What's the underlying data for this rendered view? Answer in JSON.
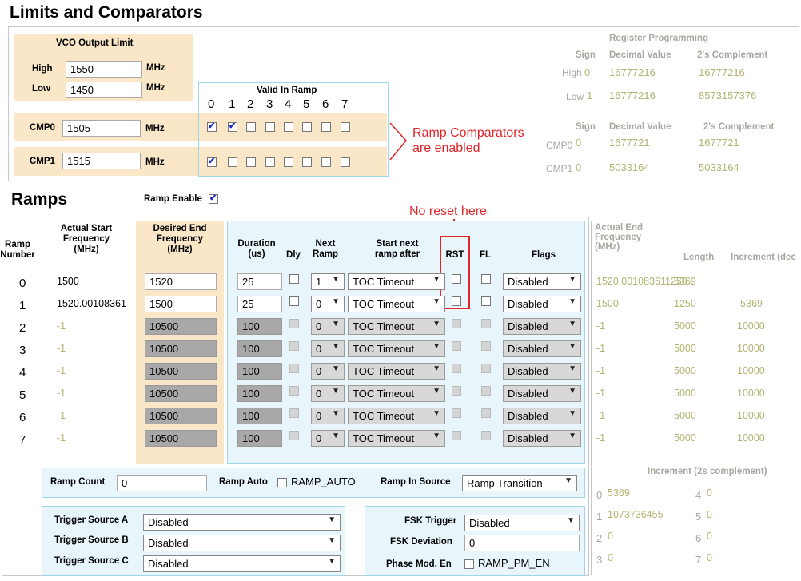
{
  "limits": {
    "title": "Limits and Comparators",
    "vco": {
      "title": "VCO Output Limit",
      "high_label": "High",
      "high_value": "1550",
      "low_label": "Low",
      "low_value": "1450",
      "unit": "MHz"
    },
    "valid": {
      "title": "Valid In Ramp",
      "numbers": [
        "0",
        "1",
        "2",
        "3",
        "4",
        "5",
        "6",
        "7"
      ],
      "cmp0_checked": [
        true,
        true,
        false,
        false,
        false,
        false,
        false,
        false
      ],
      "cmp1_checked": [
        true,
        false,
        false,
        false,
        false,
        false,
        false,
        false
      ]
    },
    "cmp0": {
      "label": "CMP0",
      "value": "1505",
      "unit": "MHz"
    },
    "cmp1": {
      "label": "CMP1",
      "value": "1515",
      "unit": "MHz"
    },
    "annotation": [
      "Ramp Comparators",
      "are enabled"
    ]
  },
  "regprog": {
    "title": "Register Programming",
    "hdr": [
      "Sign",
      "Decimal Value",
      "2's Complement"
    ],
    "high": {
      "label": "High",
      "sign": "0",
      "dec": "16777216",
      "twos": "16777216"
    },
    "low": {
      "label": "Low",
      "sign": "1",
      "dec": "16777216",
      "twos": "8573157376"
    },
    "cmp0": {
      "label": "CMP0",
      "sign": "0",
      "dec": "1677721",
      "twos": "1677721"
    },
    "cmp1": {
      "label": "CMP1",
      "sign": "0",
      "dec": "5033164",
      "twos": "5033164"
    }
  },
  "ramps": {
    "title": "Ramps",
    "enable_label": "Ramp Enable",
    "no_reset_note": "No reset here",
    "headers": {
      "ramp_number": "Ramp\nNumber",
      "actual_start": "Actual Start\nFrequency\n(MHz)",
      "desired_end": "Desired End\nFrequency\n(MHz)",
      "duration": "Duration\n(us)",
      "dly": "Dly",
      "next": "Next\nRamp",
      "start_next": "Start next\nramp after",
      "rst": "RST",
      "fl": "FL",
      "flags": "Flags",
      "actual_end": "Actual End\nFrequency\n(MHz)",
      "length": "Length",
      "increment": "Increment (dec"
    },
    "rows": [
      {
        "num": "0",
        "start": "1500",
        "end": "1520",
        "dur": "25",
        "next": "1",
        "after": "TOC Timeout",
        "flags": "Disabled",
        "act_end": "1520.001083611250",
        "length": "5369",
        "inc": "",
        "enabled": true
      },
      {
        "num": "1",
        "start": "1520.00108361",
        "end": "1500",
        "dur": "25",
        "next": "0",
        "after": "TOC Timeout",
        "flags": "Disabled",
        "act_end": "1500",
        "length": "1250",
        "inc": "-5369",
        "enabled": true
      },
      {
        "num": "2",
        "start": "-1",
        "end": "10500",
        "dur": "100",
        "next": "0",
        "after": "TOC Timeout",
        "flags": "Disabled",
        "act_end": "-1",
        "length": "5000",
        "inc": "10000",
        "enabled": false
      },
      {
        "num": "3",
        "start": "-1",
        "end": "10500",
        "dur": "100",
        "next": "0",
        "after": "TOC Timeout",
        "flags": "Disabled",
        "act_end": "-1",
        "length": "5000",
        "inc": "10000",
        "enabled": false
      },
      {
        "num": "4",
        "start": "-1",
        "end": "10500",
        "dur": "100",
        "next": "0",
        "after": "TOC Timeout",
        "flags": "Disabled",
        "act_end": "-1",
        "length": "5000",
        "inc": "10000",
        "enabled": false
      },
      {
        "num": "5",
        "start": "-1",
        "end": "10500",
        "dur": "100",
        "next": "0",
        "after": "TOC Timeout",
        "flags": "Disabled",
        "act_end": "-1",
        "length": "5000",
        "inc": "10000",
        "enabled": false
      },
      {
        "num": "6",
        "start": "-1",
        "end": "10500",
        "dur": "100",
        "next": "0",
        "after": "TOC Timeout",
        "flags": "Disabled",
        "act_end": "-1",
        "length": "5000",
        "inc": "10000",
        "enabled": false
      },
      {
        "num": "7",
        "start": "-1",
        "end": "10500",
        "dur": "100",
        "next": "0",
        "after": "TOC Timeout",
        "flags": "Disabled",
        "act_end": "-1",
        "length": "5000",
        "inc": "10000",
        "enabled": false
      }
    ]
  },
  "controls": {
    "ramp_count_label": "Ramp Count",
    "ramp_count": "0",
    "ramp_auto_label": "Ramp Auto",
    "ramp_auto_name": "RAMP_AUTO",
    "ramp_in_source_label": "Ramp In Source",
    "ramp_in_source": "Ramp Transition",
    "trigA_label": "Trigger Source A",
    "trigA": "Disabled",
    "trigB_label": "Trigger Source B",
    "trigB": "Disabled",
    "trigC_label": "Trigger Source C",
    "trigC": "Disabled",
    "fsk_trigger_label": "FSK Trigger",
    "fsk_trigger": "Disabled",
    "fsk_dev_label": "FSK Deviation",
    "fsk_dev": "0",
    "phase_mod_label": "Phase Mod. En",
    "phase_mod_name": "RAMP_PM_EN"
  },
  "inc2s": {
    "title": "Increment (2s complement)",
    "items": [
      [
        "0",
        "5369"
      ],
      [
        "1",
        "1073736455"
      ],
      [
        "2",
        "0"
      ],
      [
        "3",
        "0"
      ],
      [
        "4",
        "0"
      ],
      [
        "5",
        "0"
      ],
      [
        "6",
        "0"
      ],
      [
        "7",
        "0"
      ]
    ]
  },
  "colors": {
    "annotation_red": "#e0262b",
    "tan": "#f9e7c7",
    "light_blue": "#e8f6fb",
    "disabled_gray": "#a8a8a8",
    "olive_text": "#b3b371"
  }
}
